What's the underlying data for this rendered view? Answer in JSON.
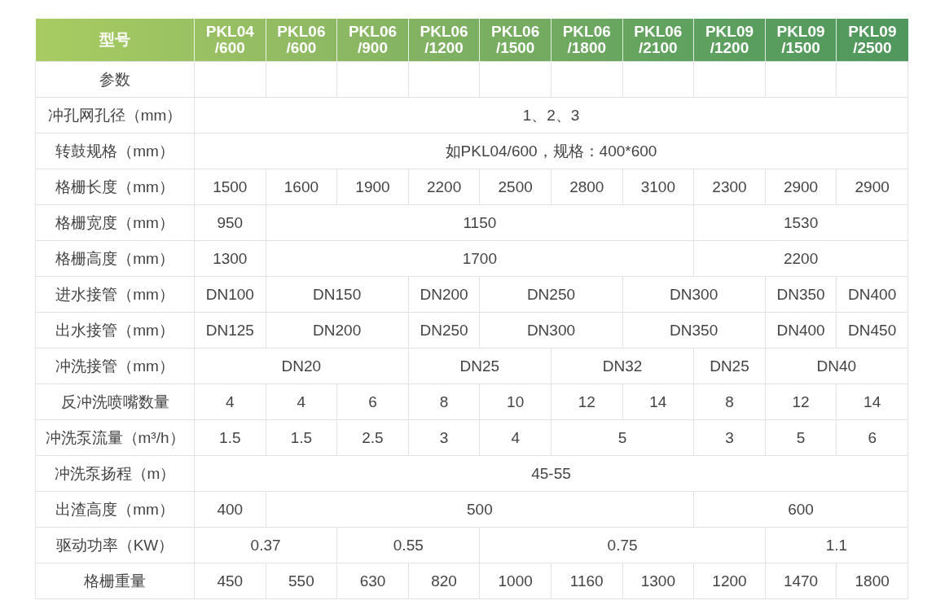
{
  "table": {
    "header": {
      "label": "型号",
      "models": [
        "PKL04\n/600",
        "PKL06\n/600",
        "PKL06\n/900",
        "PKL06\n/1200",
        "PKL06\n/1500",
        "PKL06\n/1800",
        "PKL06\n/2100",
        "PKL09\n/1200",
        "PKL09\n/1500",
        "PKL09\n/2500"
      ]
    },
    "rows": [
      {
        "label": "参数",
        "cells": []
      },
      {
        "label": "冲孔网孔径（mm）",
        "cells": [
          {
            "text": "1、2、3",
            "colspan": 10
          }
        ]
      },
      {
        "label": "转鼓规格（mm）",
        "cells": [
          {
            "text": "如PKL04/600，规格：400*600",
            "colspan": 10
          }
        ]
      },
      {
        "label": "格栅长度（mm）",
        "cells": [
          {
            "text": "1500"
          },
          {
            "text": "1600"
          },
          {
            "text": "1900"
          },
          {
            "text": "2200"
          },
          {
            "text": "2500"
          },
          {
            "text": "2800"
          },
          {
            "text": "3100"
          },
          {
            "text": "2300"
          },
          {
            "text": "2900"
          },
          {
            "text": "2900"
          }
        ]
      },
      {
        "label": "格栅宽度（mm）",
        "cells": [
          {
            "text": "950"
          },
          {
            "text": "1150",
            "colspan": 6
          },
          {
            "text": "1530",
            "colspan": 3
          }
        ]
      },
      {
        "label": "格栅高度（mm）",
        "cells": [
          {
            "text": "1300"
          },
          {
            "text": "1700",
            "colspan": 6
          },
          {
            "text": "2200",
            "colspan": 3
          }
        ]
      },
      {
        "label": "进水接管（mm）",
        "cells": [
          {
            "text": "DN100"
          },
          {
            "text": "DN150",
            "colspan": 2
          },
          {
            "text": "DN200"
          },
          {
            "text": "DN250",
            "colspan": 2
          },
          {
            "text": "DN300",
            "colspan": 2
          },
          {
            "text": "DN350"
          },
          {
            "text": "DN400"
          }
        ]
      },
      {
        "label": "出水接管（mm）",
        "cells": [
          {
            "text": "DN125"
          },
          {
            "text": "DN200",
            "colspan": 2
          },
          {
            "text": "DN250"
          },
          {
            "text": "DN300",
            "colspan": 2
          },
          {
            "text": "DN350",
            "colspan": 2
          },
          {
            "text": "DN400"
          },
          {
            "text": "DN450"
          }
        ]
      },
      {
        "label": "冲洗接管（mm）",
        "cells": [
          {
            "text": "DN20",
            "colspan": 3
          },
          {
            "text": "DN25",
            "colspan": 2
          },
          {
            "text": "DN32",
            "colspan": 2
          },
          {
            "text": "DN25"
          },
          {
            "text": "DN40",
            "colspan": 2
          }
        ]
      },
      {
        "label": "反冲洗喷嘴数量",
        "cells": [
          {
            "text": "4"
          },
          {
            "text": "4"
          },
          {
            "text": "6"
          },
          {
            "text": "8"
          },
          {
            "text": "10"
          },
          {
            "text": "12"
          },
          {
            "text": "14"
          },
          {
            "text": "8"
          },
          {
            "text": "12"
          },
          {
            "text": "14"
          }
        ]
      },
      {
        "label": "冲洗泵流量（m³/h）",
        "cells": [
          {
            "text": "1.5"
          },
          {
            "text": "1.5"
          },
          {
            "text": "2.5"
          },
          {
            "text": "3"
          },
          {
            "text": "4"
          },
          {
            "text": "5",
            "colspan": 2
          },
          {
            "text": "3"
          },
          {
            "text": "5"
          },
          {
            "text": "6"
          }
        ]
      },
      {
        "label": "冲洗泵扬程（m）",
        "cells": [
          {
            "text": "45-55",
            "colspan": 10
          }
        ]
      },
      {
        "label": "出渣高度（mm）",
        "cells": [
          {
            "text": "400"
          },
          {
            "text": "500",
            "colspan": 6
          },
          {
            "text": "600",
            "colspan": 3
          }
        ]
      },
      {
        "label": "驱动功率（KW）",
        "cells": [
          {
            "text": "0.37",
            "colspan": 2
          },
          {
            "text": "0.55",
            "colspan": 2
          },
          {
            "text": "0.75",
            "colspan": 4
          },
          {
            "text": "1.1",
            "colspan": 2
          }
        ]
      },
      {
        "label": "格栅重量",
        "cells": [
          {
            "text": "450"
          },
          {
            "text": "550"
          },
          {
            "text": "630"
          },
          {
            "text": "820"
          },
          {
            "text": "1000"
          },
          {
            "text": "1160"
          },
          {
            "text": "1300"
          },
          {
            "text": "1200"
          },
          {
            "text": "1470"
          },
          {
            "text": "1800"
          }
        ]
      }
    ]
  }
}
